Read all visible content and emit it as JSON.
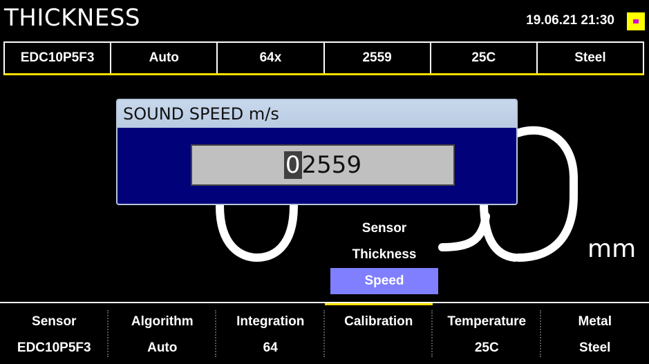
{
  "header": {
    "title": "THICKNESS",
    "datetime": "19.06.21 21:30",
    "battery_icon": "battery-icon"
  },
  "status": [
    "EDC10P5F3",
    "Auto",
    "64x",
    "2559",
    "25C",
    "Steel"
  ],
  "measurement": {
    "unit": "mm"
  },
  "menu": {
    "items": [
      {
        "label": "Sensor"
      },
      {
        "label": "Thickness"
      },
      {
        "label": "Speed"
      }
    ],
    "selected": "Speed"
  },
  "dialog": {
    "title": "SOUND SPEED m/s",
    "value_cursor_digit": "0",
    "value_rest": "2559"
  },
  "bottom_tabs": [
    {
      "label": "Sensor",
      "value": "EDC10P5F3"
    },
    {
      "label": "Algorithm",
      "value": "Auto"
    },
    {
      "label": "Integration",
      "value": "64"
    },
    {
      "label": "Calibration",
      "value": ""
    },
    {
      "label": "Temperature",
      "value": "25C"
    },
    {
      "label": "Metal",
      "value": "Steel"
    }
  ],
  "colors": {
    "accent_yellow": "#ffe000",
    "dialog_bg": "#01017a",
    "menu_selected": "#7f7fff",
    "battery": "#ffff00",
    "battery_indicator": "#d400d4"
  }
}
